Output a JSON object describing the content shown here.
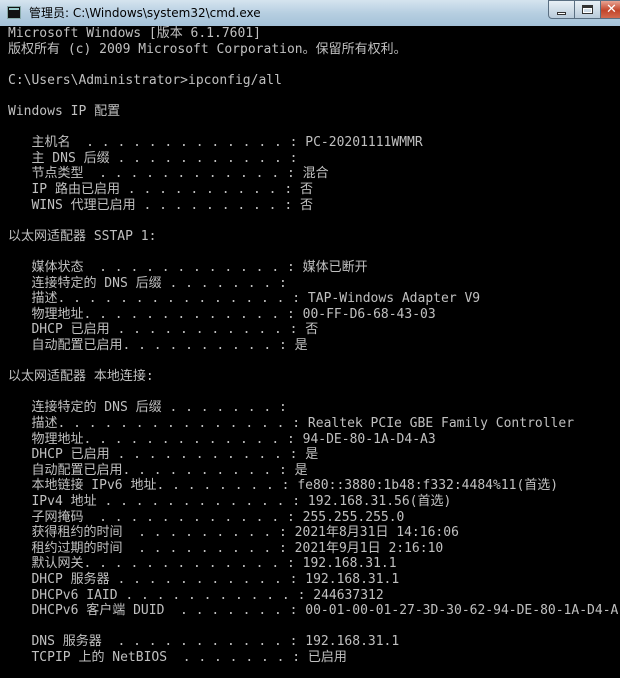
{
  "window": {
    "title": "管理员: C:\\Windows\\system32\\cmd.exe",
    "icon": "cmd-icon"
  },
  "console": {
    "lines": [
      "Microsoft Windows [版本 6.1.7601]",
      "版权所有 (c) 2009 Microsoft Corporation。保留所有权利。",
      "",
      "C:\\Users\\Administrator>ipconfig/all",
      "",
      "Windows IP 配置",
      "",
      "   主机名  . . . . . . . . . . . . . : PC-20201111WMMR",
      "   主 DNS 后缀 . . . . . . . . . . . :",
      "   节点类型  . . . . . . . . . . . . : 混合",
      "   IP 路由已启用 . . . . . . . . . . : 否",
      "   WINS 代理已启用 . . . . . . . . . : 否",
      "",
      "以太网适配器 SSTAP 1:",
      "",
      "   媒体状态  . . . . . . . . . . . . : 媒体已断开",
      "   连接特定的 DNS 后缀 . . . . . . . :",
      "   描述. . . . . . . . . . . . . . . : TAP-Windows Adapter V9",
      "   物理地址. . . . . . . . . . . . . : 00-FF-D6-68-43-03",
      "   DHCP 已启用 . . . . . . . . . . . : 否",
      "   自动配置已启用. . . . . . . . . . : 是",
      "",
      "以太网适配器 本地连接:",
      "",
      "   连接特定的 DNS 后缀 . . . . . . . :",
      "   描述. . . . . . . . . . . . . . . : Realtek PCIe GBE Family Controller",
      "   物理地址. . . . . . . . . . . . . : 94-DE-80-1A-D4-A3",
      "   DHCP 已启用 . . . . . . . . . . . : 是",
      "   自动配置已启用. . . . . . . . . . : 是",
      "   本地链接 IPv6 地址. . . . . . . . : fe80::3880:1b48:f332:4484%11(首选)",
      "   IPv4 地址 . . . . . . . . . . . . : 192.168.31.56(首选)",
      "   子网掩码  . . . . . . . . . . . . : 255.255.255.0",
      "   获得租约的时间  . . . . . . . . . : 2021年8月31日 14:16:06",
      "   租约过期的时间  . . . . . . . . . : 2021年9月1日 2:16:10",
      "   默认网关. . . . . . . . . . . . . : 192.168.31.1",
      "   DHCP 服务器 . . . . . . . . . . . : 192.168.31.1",
      "   DHCPv6 IAID . . . . . . . . . . . : 244637312",
      "   DHCPv6 客户端 DUID  . . . . . . . : 00-01-00-01-27-3D-30-62-94-DE-80-1A-D4-A",
      "",
      "   DNS 服务器  . . . . . . . . . . . : 192.168.31.1",
      "   TCPIP 上的 NetBIOS  . . . . . . . : 已启用"
    ]
  }
}
